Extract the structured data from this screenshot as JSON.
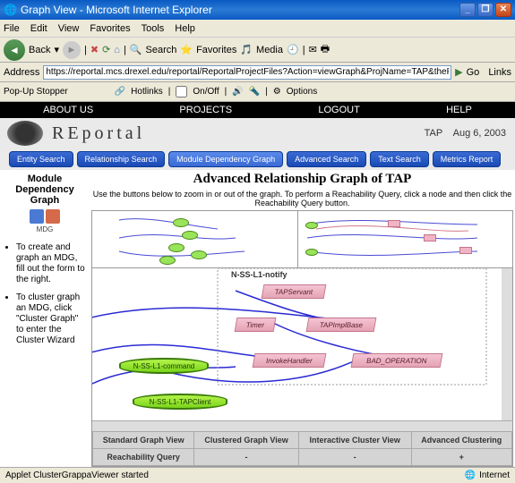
{
  "window": {
    "title": "Graph View - Microsoft Internet Explorer"
  },
  "menu": {
    "file": "File",
    "edit": "Edit",
    "view": "View",
    "favorites": "Favorites",
    "tools": "Tools",
    "help": "Help"
  },
  "toolbar": {
    "back": "Back",
    "search": "Search",
    "favorites": "Favorites",
    "media": "Media"
  },
  "address": {
    "label": "Address",
    "url": "https://reportal.mcs.drexel.edu/reportal/ReportalProjectFiles?Action=viewGraph&ProjName=TAP&theProject=TAP&querymode=applet&querytype=relationship&classtype=java&gtype=",
    "go": "Go",
    "links": "Links"
  },
  "toolbar2": {
    "popup": "Pop-Up Stopper",
    "hotlinks": "Hotlinks",
    "onoff": "On/Off",
    "options": "Options"
  },
  "nav": {
    "about": "ABOUT US",
    "projects": "PROJECTS",
    "logout": "LOGOUT",
    "help": "HELP"
  },
  "header": {
    "logo_text": "REportal",
    "app": "TAP",
    "date": "Aug 6, 2003"
  },
  "tabs": {
    "entity": "Entity Search",
    "relationship": "Relationship Search",
    "mdg": "Module Dependency Graph",
    "advanced": "Advanced Search",
    "text": "Text Search",
    "metrics": "Metrics Report"
  },
  "sidebar": {
    "title": "Module Dependency Graph",
    "icon_label": "MDG",
    "icon2": "Cluster Graph",
    "items": [
      "To create and graph an MDG, fill out the form to the right.",
      "To cluster graph an MDG, click \"Cluster Graph\" to enter the Cluster Wizard"
    ]
  },
  "main": {
    "title": "Advanced Relationship Graph of TAP",
    "instructions": "Use the buttons below to zoom in or out of the graph. To perform a Reachability Query, click a node and then click the Reachability Query button."
  },
  "graph": {
    "cluster_label": "N-SS-L1-notify",
    "nodes_green": [
      "N-SS-L1-command",
      "N-SS-L1-TAPClient"
    ],
    "nodes_pink": [
      "TAPServant",
      "Timer",
      "TAPImplBase",
      "InvokeHandler",
      "BAD_OPERATION"
    ]
  },
  "table": {
    "row1": [
      "Standard Graph View",
      "Clustered Graph View",
      "Interactive Cluster View",
      "Advanced Clustering"
    ],
    "row2": [
      "Reachability Query",
      "-",
      "-",
      "+"
    ]
  },
  "status": {
    "left": "Applet ClusterGrappaViewer started",
    "zone": "Internet"
  }
}
